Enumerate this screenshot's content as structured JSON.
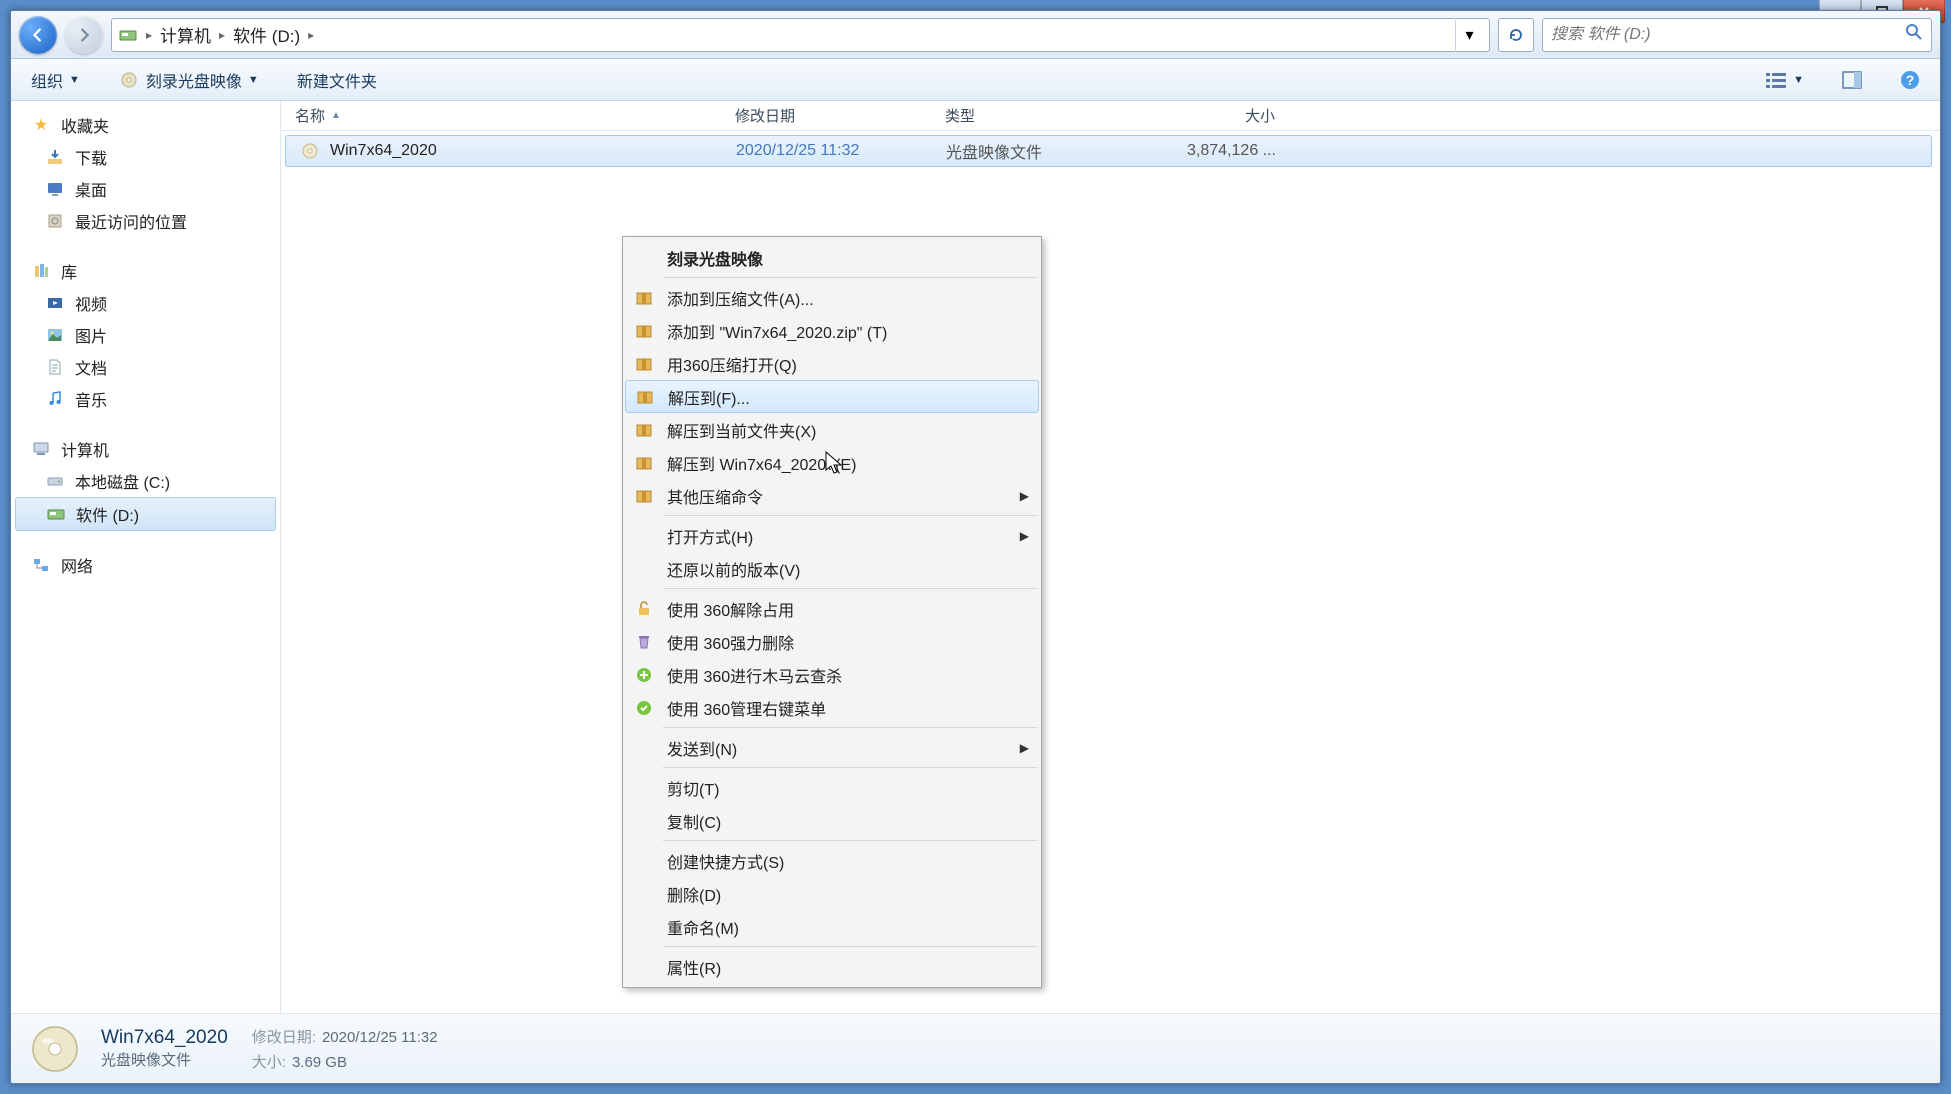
{
  "breadcrumb": {
    "computer": "计算机",
    "location": "软件 (D:)"
  },
  "search": {
    "placeholder": "搜索 软件 (D:)"
  },
  "toolbar": {
    "organize": "组织",
    "burn": "刻录光盘映像",
    "newfolder": "新建文件夹"
  },
  "sidebar": {
    "favorites": {
      "header": "收藏夹",
      "downloads": "下载",
      "desktop": "桌面",
      "recent": "最近访问的位置"
    },
    "libraries": {
      "header": "库",
      "videos": "视频",
      "pictures": "图片",
      "documents": "文档",
      "music": "音乐"
    },
    "computer": {
      "header": "计算机",
      "localc": "本地磁盘 (C:)",
      "softd": "软件 (D:)"
    },
    "network": {
      "header": "网络"
    }
  },
  "columns": {
    "name": "名称",
    "date": "修改日期",
    "type": "类型",
    "size": "大小"
  },
  "file": {
    "name": "Win7x64_2020",
    "date": "2020/12/25 11:32",
    "type": "光盘映像文件",
    "size": "3,874,126 ..."
  },
  "context": {
    "burn": "刻录光盘映像",
    "addArchive": "添加到压缩文件(A)...",
    "addZip": "添加到 \"Win7x64_2020.zip\" (T)",
    "openWith360": "用360压缩打开(Q)",
    "extractTo": "解压到(F)...",
    "extractHere": "解压到当前文件夹(X)",
    "extractNamed": "解压到 Win7x64_2020\\ (E)",
    "otherCompress": "其他压缩命令",
    "openWith": "打开方式(H)",
    "restorePrev": "还原以前的版本(V)",
    "unlock360": "使用 360解除占用",
    "forceDel360": "使用 360强力删除",
    "trojan360": "使用 360进行木马云查杀",
    "manage360": "使用 360管理右键菜单",
    "sendTo": "发送到(N)",
    "cut": "剪切(T)",
    "copy": "复制(C)",
    "shortcut": "创建快捷方式(S)",
    "delete": "删除(D)",
    "rename": "重命名(M)",
    "properties": "属性(R)"
  },
  "details": {
    "title": "Win7x64_2020",
    "subtitle": "光盘映像文件",
    "dateLabel": "修改日期:",
    "dateVal": "2020/12/25 11:32",
    "sizeLabel": "大小:",
    "sizeVal": "3.69 GB"
  }
}
